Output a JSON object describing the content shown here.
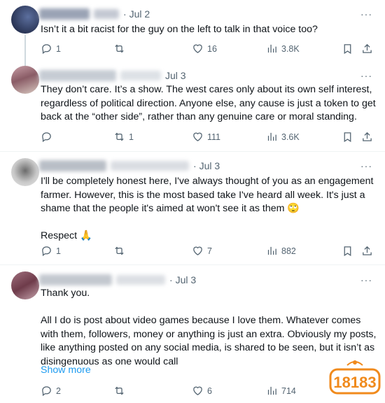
{
  "tweets": [
    {
      "date": "Jul 2",
      "text": "Isn’t it a bit racist for the guy on the left to talk in that voice too?",
      "reply_count": "1",
      "retweet_count": "",
      "like_count": "16",
      "view_count": "3.8K"
    },
    {
      "date": "Jul 3",
      "text": "They don’t care. It’s a show. The west cares only about its own self interest, regardless of political direction. Anyone else, any cause is just a token to get back at the “other side”, rather than any genuine care or moral standing.",
      "reply_count": "",
      "retweet_count": "1",
      "like_count": "111",
      "view_count": "3.6K"
    },
    {
      "date": "Jul 3",
      "text": "I'll be completely honest here, I've always thought of you as an engagement farmer. However, this is the most based take I've heard all week. It's just a shame that the people it's aimed at won't see it as them 🙄\n\nRespect 🙏",
      "reply_count": "1",
      "retweet_count": "",
      "like_count": "7",
      "view_count": "882"
    },
    {
      "date": "Jul 3",
      "text": "Thank you.\n\nAll I do is post about video games because I love them. Whatever comes with them, followers, money or anything is just an extra. Obviously my posts, like anything posted on any social media, is shared to be seen, but it isn’t as disingenuous as one would call",
      "show_more": "Show more",
      "reply_count": "2",
      "retweet_count": "",
      "like_count": "6",
      "view_count": "714"
    }
  ],
  "more_label": "···",
  "separator": "·",
  "watermark_text": "18183",
  "colors": {
    "text": "#0f1419",
    "secondary": "#536471",
    "link": "#1d9bf0",
    "divider": "#eff3f4",
    "thread_line": "#cfd9de",
    "watermark_orange": "#f08a1c"
  }
}
